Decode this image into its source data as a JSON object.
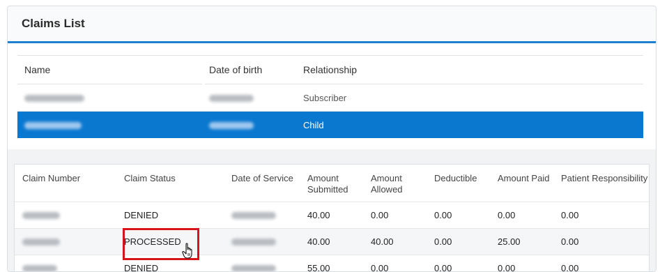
{
  "panel": {
    "title": "Claims List"
  },
  "members": {
    "headers": {
      "name": "Name",
      "dob": "Date of birth",
      "relationship": "Relationship"
    },
    "rows": [
      {
        "relationship": "Subscriber",
        "selected": false
      },
      {
        "relationship": "Child",
        "selected": true
      }
    ]
  },
  "claims": {
    "headers": {
      "number": "Claim Number",
      "status": "Claim Status",
      "date": "Date of Service",
      "submitted": "Amount Submitted",
      "allowed": "Amount Allowed",
      "deductible": "Deductible",
      "paid": "Amount Paid",
      "patient": "Patient Responsibility"
    },
    "rows": [
      {
        "status": "DENIED",
        "submitted": "40.00",
        "allowed": "0.00",
        "deductible": "0.00",
        "paid": "0.00",
        "patient": "0.00"
      },
      {
        "status": "PROCESSED",
        "submitted": "40.00",
        "allowed": "40.00",
        "deductible": "0.00",
        "paid": "25.00",
        "patient": "0.00"
      },
      {
        "status": "DENIED",
        "submitted": "55.00",
        "allowed": "0.00",
        "deductible": "0.00",
        "paid": "0.00",
        "patient": "0.00"
      }
    ]
  },
  "icons": {
    "cursor": "hand-pointer-icon"
  },
  "colors": {
    "accent": "#0b78d0",
    "highlight": "#d8141b"
  }
}
